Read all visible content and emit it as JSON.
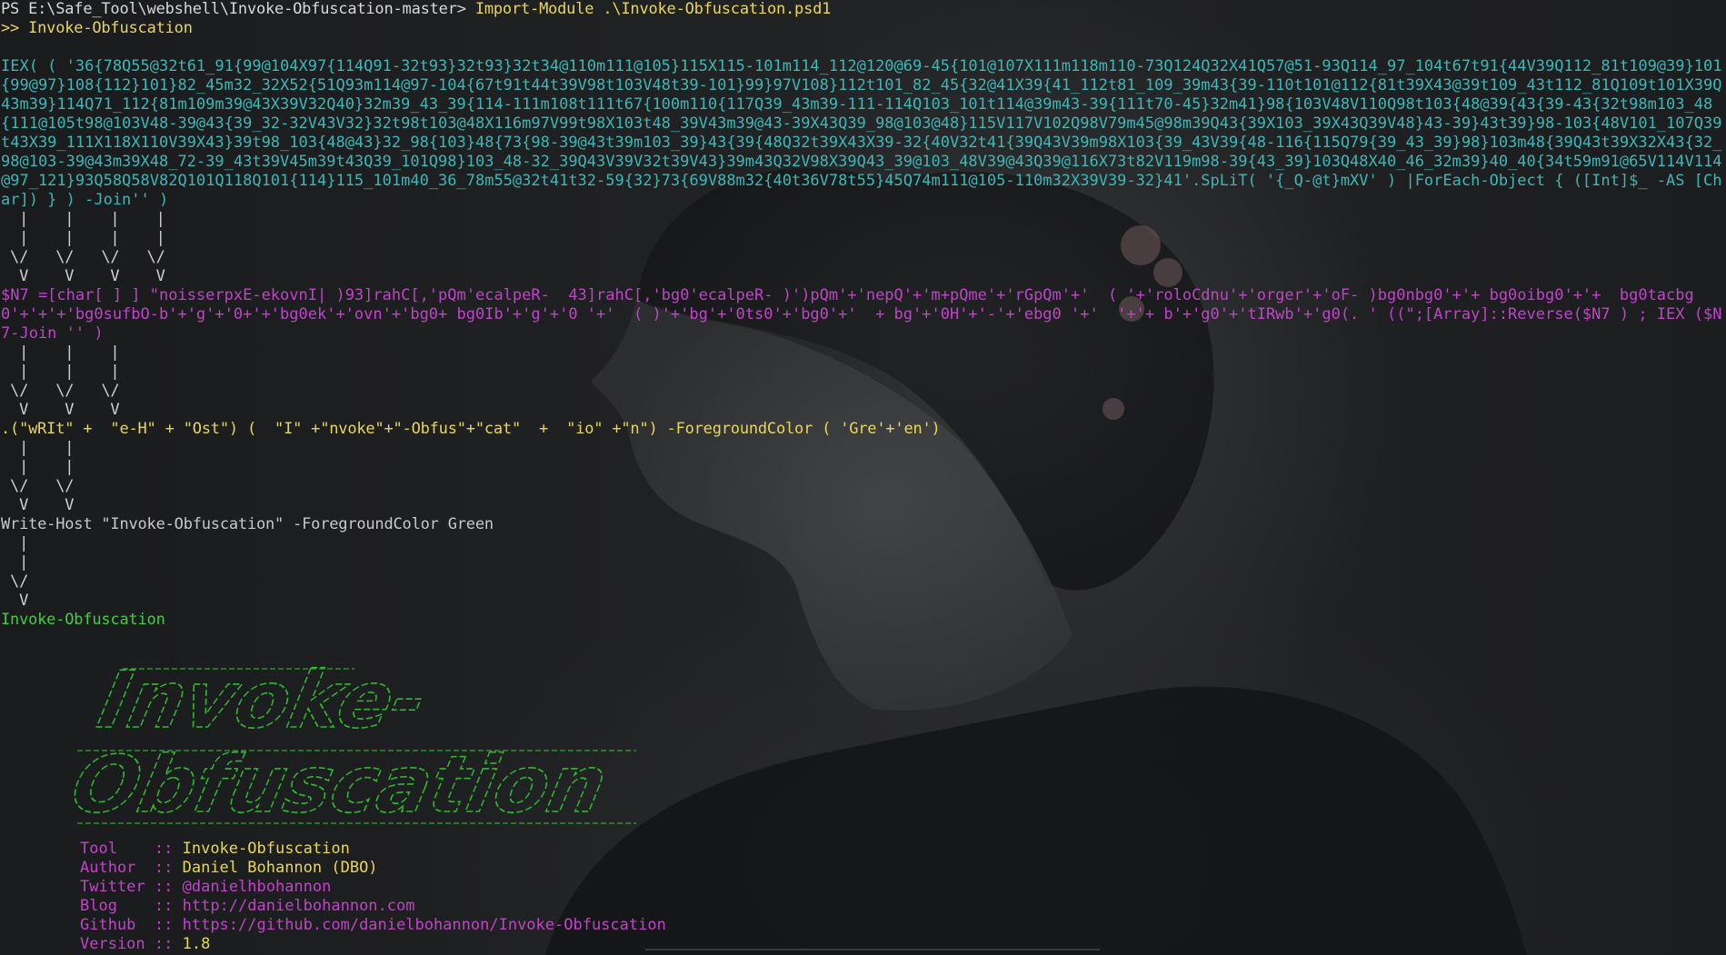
{
  "prompt": {
    "ps_line": "PS E:\\Safe_Tool\\webshell\\Invoke-Obfuscation-master> ",
    "import_cmd": "Import-Module .\\Invoke-Obfuscation.psd1",
    "continuation": ">> ",
    "continuation_cmd": "Invoke-Obfuscation"
  },
  "obfuscated_layer1": "IEX( ( '36{78Q55@32t61_91{99@104X97{114Q91-32t93}32t93}32t34@110m111@105}115X115-101m114_112@120@69-45{101@107X111m118m110-73Q124Q32X41Q57@51-93Q114_97_104t67t91{44V39Q112_81t109@39}101{99@97}108{112}101}82_45m32_32X52{51Q93m114@97-104{67t91t44t39V98t103V48t39-101}99}97V108}112t101_82_45{32@41X39{41_112t81_109_39m43{39-110t101@112{81t39X43@39t109_43t112_81Q109t101X39Q43m39}114Q71_112{81m109m39@43X39V32Q40}32m39_43_39{114-111m108t111t67{100m110{117Q39_43m39-111-114Q103_101t114@39m43-39{111t70-45}32m41}98{103V48V110Q98t103{48@39{43{39-43{32t98m103_48{111@105t98@103V48-39@43{39_32-32V43V32}32t98t103@48X116m97V99t98X103t48_39V43m39@43-39X43Q39_98@103@48}115V117V102Q98V79m45@98m39Q43{39X103_39X43Q39V48}43-39}43t39}98-103{48V101_107Q39t43X39_111X118X110V39X43}39t98_103{48@43}32_98{103}48{73{98-39@43t39m103_39}43{39{48Q32t39X43X39-32{40V32t41{39Q43V39m98X103{39_43V39{48-116{115Q79{39_43_39}98}103m48{39Q43t39X32X43{32_98@103-39@43m39X48_72-39_43t39V45m39t43Q39_101Q98}103_48-32_39Q43V39V32t39V43}39m43Q32V98X39Q43_39@103_48V39@43Q39@116X73t82V119m98-39{43_39}103Q48X40_46_32m39}40_40{34t59m91@65V114V114@97_121}93Q58Q58V82Q101Q118Q101{114}115_101m40_36_78m55@32t41t32-59{32}73{69V88m32{40t36V78t55}45Q74m111@105-110m32X39V39-32}41'.SpLiT( '{_Q-@t}mXV' ) |ForEach-Object { ([Int]$_ -AS [Char]) } ) -Join'' )",
  "obfuscated_layer2": "$N7 =[char[ ] ] \"noisserpxE-ekovnI| )93]rahC[,'pQm'ecalpeR-  43]rahC[,'bg0'ecalpeR- )')pQm'+'nepQ'+'m+pQme'+'rGpQm'+'  ( '+'roloCdnu'+'orger'+'oF- )bg0nbg0'+'+ bg0oibg0'+'+  bg0tacbg0'+'+'+'bg0sufbO-b'+'g'+'0+'+'bg0ek'+'ovn'+'bg0+ bg0Ib'+'g'+'0 '+'  ( )'+'bg'+'0ts0'+'bg0'+'  + bg'+'0H'+'-'+'ebg0 '+'  '+'+ b'+'g0'+'tIRwb'+'g0(. ' ((\";[Array]::Reverse($N7 ) ; IEX ($N7-Join '' ) ",
  "obfuscated_layer3": ".(\"wRIt\" +  \"e-H\" + \"Ost\") (  \"I\" +\"nvoke\"+\"-Obfus\"+\"cat\"  +  \"io\" +\"n\") -ForegroundColor ( 'Gre'+'en')",
  "plain_cmd": "Write-Host \"Invoke-Obfuscation\" -ForegroundColor Green",
  "result_output": "Invoke-Obfuscation",
  "arrows": {
    "pipe": "|",
    "head_top": "\\/",
    "head_bottom": "V"
  },
  "banner": {
    "title_line1": "Invoke-",
    "title_line2": "Obfuscation"
  },
  "info": [
    {
      "key": "Tool    ",
      "sep": ":: ",
      "value": "Invoke-Obfuscation"
    },
    {
      "key": "Author  ",
      "sep": ":: ",
      "value": "Daniel Bohannon (DBO)"
    },
    {
      "key": "Twitter ",
      "sep": ":: ",
      "value": "@danielhbohannon"
    },
    {
      "key": "Blog    ",
      "sep": ":: ",
      "value": "http://danielbohannon.com"
    },
    {
      "key": "Github  ",
      "sep": ":: ",
      "value": "https://github.com/danielbohannon/Invoke-Obfuscation"
    },
    {
      "key": "Version ",
      "sep": ":: ",
      "value": "1.8"
    }
  ],
  "colors": {
    "yellow": "#e8d65a",
    "cyan": "#3fb6b6",
    "magenta": "#c044c8",
    "green": "#3fcf3f",
    "white": "#d8d8d8"
  }
}
